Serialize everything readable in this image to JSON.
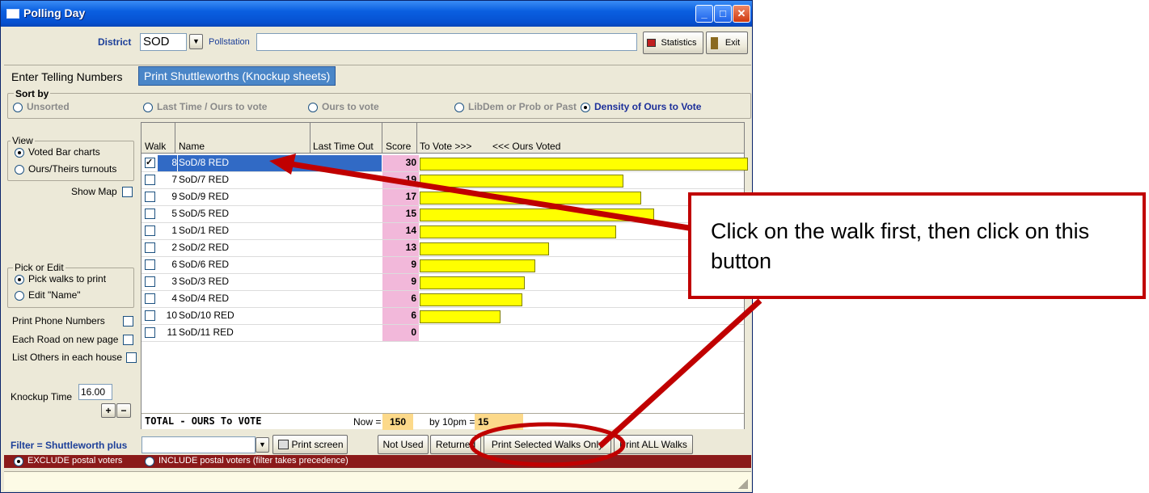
{
  "window": {
    "title": "Polling Day"
  },
  "toolbar": {
    "district_label": "District",
    "district_value": "SOD",
    "pollstation_label": "Pollstation",
    "pollstation_value": "",
    "statistics_label": "Statistics",
    "exit_label": "Exit"
  },
  "tabs": [
    {
      "label": "Enter Telling Numbers",
      "active": false
    },
    {
      "label": "Print Shuttleworths (Knockup sheets)",
      "active": true
    }
  ],
  "sort": {
    "caption": "Sort by",
    "options": [
      "Unsorted",
      "Last Time / Ours to vote",
      "Ours to vote",
      "LibDem or Prob or Past",
      "Density of Ours to Vote"
    ],
    "selected_index": 4
  },
  "view": {
    "caption": "View",
    "options": [
      "Voted Bar charts",
      "Ours/Theirs turnouts"
    ],
    "selected_index": 0,
    "show_map_label": "Show Map"
  },
  "pick": {
    "caption": "Pick or Edit",
    "options": [
      "Pick walks to print",
      "Edit \"Name\""
    ],
    "selected_index": 0
  },
  "options": {
    "print_phone": "Print Phone Numbers",
    "each_road": "Each Road on new page",
    "list_others": "List Others in each house"
  },
  "knockup": {
    "label": "Knockup Time",
    "value": "16.00",
    "plus": "+",
    "minus": "−"
  },
  "grid": {
    "headers": {
      "walk": "Walk",
      "name": "Name",
      "last_time": "Last Time Out",
      "score": "Score",
      "to_vote": "To Vote >>>",
      "ours_voted": "<<< Ours Voted"
    },
    "max_bar_value": 30,
    "rows": [
      {
        "checked": true,
        "walk": "8",
        "name": "SoD/8 RED",
        "score": "30",
        "bar": 30,
        "selected": true
      },
      {
        "checked": false,
        "walk": "7",
        "name": "SoD/7 RED",
        "score": "19",
        "bar": 18.6
      },
      {
        "checked": false,
        "walk": "9",
        "name": "SoD/9 RED",
        "score": "17",
        "bar": 20.2
      },
      {
        "checked": false,
        "walk": "5",
        "name": "SoD/5 RED",
        "score": "15",
        "bar": 21.4
      },
      {
        "checked": false,
        "walk": "1",
        "name": "SoD/1 RED",
        "score": "14",
        "bar": 17.9
      },
      {
        "checked": false,
        "walk": "2",
        "name": "SoD/2 RED",
        "score": "13",
        "bar": 11.7
      },
      {
        "checked": false,
        "walk": "6",
        "name": "SoD/6 RED",
        "score": "9",
        "bar": 10.5
      },
      {
        "checked": false,
        "walk": "3",
        "name": "SoD/3 RED",
        "score": "9",
        "bar": 9.5
      },
      {
        "checked": false,
        "walk": "4",
        "name": "SoD/4 RED",
        "score": "6",
        "bar": 9.3
      },
      {
        "checked": false,
        "walk": "10",
        "name": "SoD/10 RED",
        "score": "6",
        "bar": 7.3
      },
      {
        "checked": false,
        "walk": "11",
        "name": "SoD/11 RED",
        "score": "0",
        "bar": 0
      }
    ]
  },
  "totals": {
    "label": "TOTAL   -   OURS To VOTE",
    "now_label": "Now =",
    "now_value": "150",
    "by10_label": "by 10pm =",
    "by10_value": "15"
  },
  "bottom": {
    "filter_label": "Filter = Shuttleworth plus",
    "filter_value": "",
    "print_screen": "Print screen",
    "not_used": "Not Used",
    "returned": "Returned",
    "print_selected": "Print Selected Walks Only",
    "print_all": "Print ALL Walks",
    "exclude_postal": "EXCLUDE postal voters",
    "include_postal": "INCLUDE postal voters (filter takes precedence)"
  },
  "callout": {
    "text": "Click on the walk first, then click on this button"
  }
}
